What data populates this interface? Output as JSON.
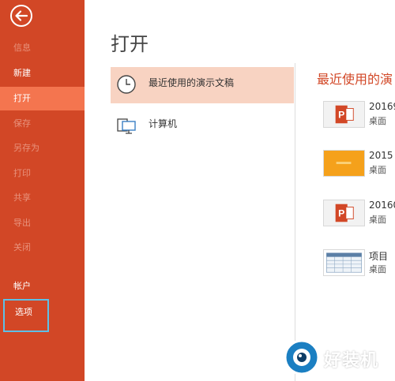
{
  "sidebar": {
    "items": [
      {
        "label": "信息",
        "state": "disabled"
      },
      {
        "label": "新建",
        "state": "normal"
      },
      {
        "label": "打开",
        "state": "active"
      },
      {
        "label": "保存",
        "state": "disabled"
      },
      {
        "label": "另存为",
        "state": "disabled"
      },
      {
        "label": "打印",
        "state": "disabled"
      },
      {
        "label": "共享",
        "state": "disabled"
      },
      {
        "label": "导出",
        "state": "disabled"
      },
      {
        "label": "关闭",
        "state": "disabled"
      },
      {
        "label": "帐户",
        "state": "normal"
      },
      {
        "label": "选项",
        "state": "highlighted"
      }
    ],
    "back_icon": "back-arrow-icon"
  },
  "main": {
    "title": "打开",
    "places": [
      {
        "label": "最近使用的演示文稿",
        "icon": "clock-icon",
        "selected": true
      },
      {
        "label": "计算机",
        "icon": "computer-icon",
        "selected": false
      }
    ]
  },
  "recent": {
    "title": "最近使用的演",
    "files": [
      {
        "name": "20169",
        "location": "桌面",
        "thumb": "powerpoint-icon"
      },
      {
        "name": "2015",
        "location": "桌面",
        "thumb": "orange-slide-thumbnail"
      },
      {
        "name": "20160",
        "location": "桌面",
        "thumb": "powerpoint-icon"
      },
      {
        "name": "项目",
        "location": "桌面",
        "thumb": "table-slide-thumbnail"
      }
    ]
  },
  "watermark": {
    "text": "好装机"
  },
  "colors": {
    "sidebar_bg": "#d24726",
    "sidebar_active": "#f4754f",
    "selected_place_bg": "#f8d3c2",
    "accent_text": "#d24726",
    "highlight_box": "#5ec0e6"
  }
}
